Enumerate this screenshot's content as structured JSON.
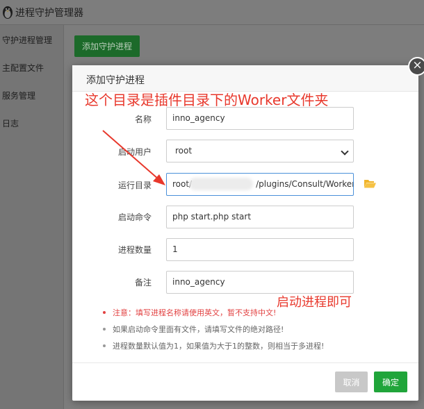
{
  "app": {
    "title": "进程守护管理器"
  },
  "sidebar": {
    "items": [
      {
        "label": "守护进程管理"
      },
      {
        "label": "主配置文件"
      },
      {
        "label": "服务管理"
      },
      {
        "label": "日志"
      }
    ]
  },
  "toolbar": {
    "add_label": "添加守护进程"
  },
  "modal": {
    "title": "添加守护进程",
    "close_icon": "×",
    "fields": {
      "name_label": "名称",
      "name_value": "inno_agency",
      "user_label": "启动用户",
      "user_value": "root",
      "dir_label": "运行目录",
      "dir_value_start": "root/",
      "dir_value_end": "/plugins/Consult/Worker/",
      "cmd_label": "启动命令",
      "cmd_value": "php start.php start",
      "count_label": "进程数量",
      "count_value": "1",
      "note_label": "备注",
      "note_value": "inno_agency"
    },
    "tips": [
      "注意：填写进程名称请使用英文，暂不支持中文!",
      "如果启动命令里面有文件，请填写文件的绝对路径!",
      "进程数量默认值为1，如果值为大于1的整数，则相当于多进程!"
    ],
    "cancel_label": "取消",
    "confirm_label": "确定"
  },
  "annotations": {
    "top": "这个目录是插件目录下的Worker文件夹",
    "bottom": "启动进程即可"
  },
  "colors": {
    "accent": "#20a53a",
    "annotation": "#e8382c",
    "warning": "#e24141"
  }
}
